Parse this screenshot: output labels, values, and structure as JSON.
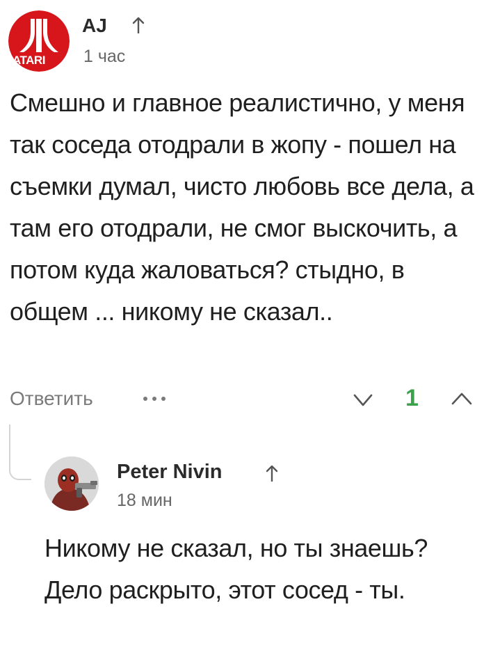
{
  "comment": {
    "author": "AJ",
    "avatar_icon": "atari-logo-avatar",
    "avatar_text": "ATARI",
    "time": "1 час",
    "text": "Смешно и главное реалистично, у меня так соседа отодрали в жопу - пошел на съемки думал, чисто любовь все дела, а там его отодрали, не смог выскочить, а потом куда жаловаться? стыдно, в общем ... никому не сказал.."
  },
  "actions": {
    "reply_label": "Ответить",
    "more_label": "•••",
    "vote_count": "1",
    "vote_count_color": "#3ba14a"
  },
  "reply": {
    "author": "Peter Nivin",
    "avatar_icon": "character-with-gun-avatar",
    "time": "18 мин",
    "text": "Никому не сказал, но ты знаешь? Дело раскрыто, этот сосед - ты."
  },
  "colors": {
    "atari_red": "#d7161b",
    "muted_text": "#7a7a7a",
    "thread_line": "#d4d4d4"
  }
}
